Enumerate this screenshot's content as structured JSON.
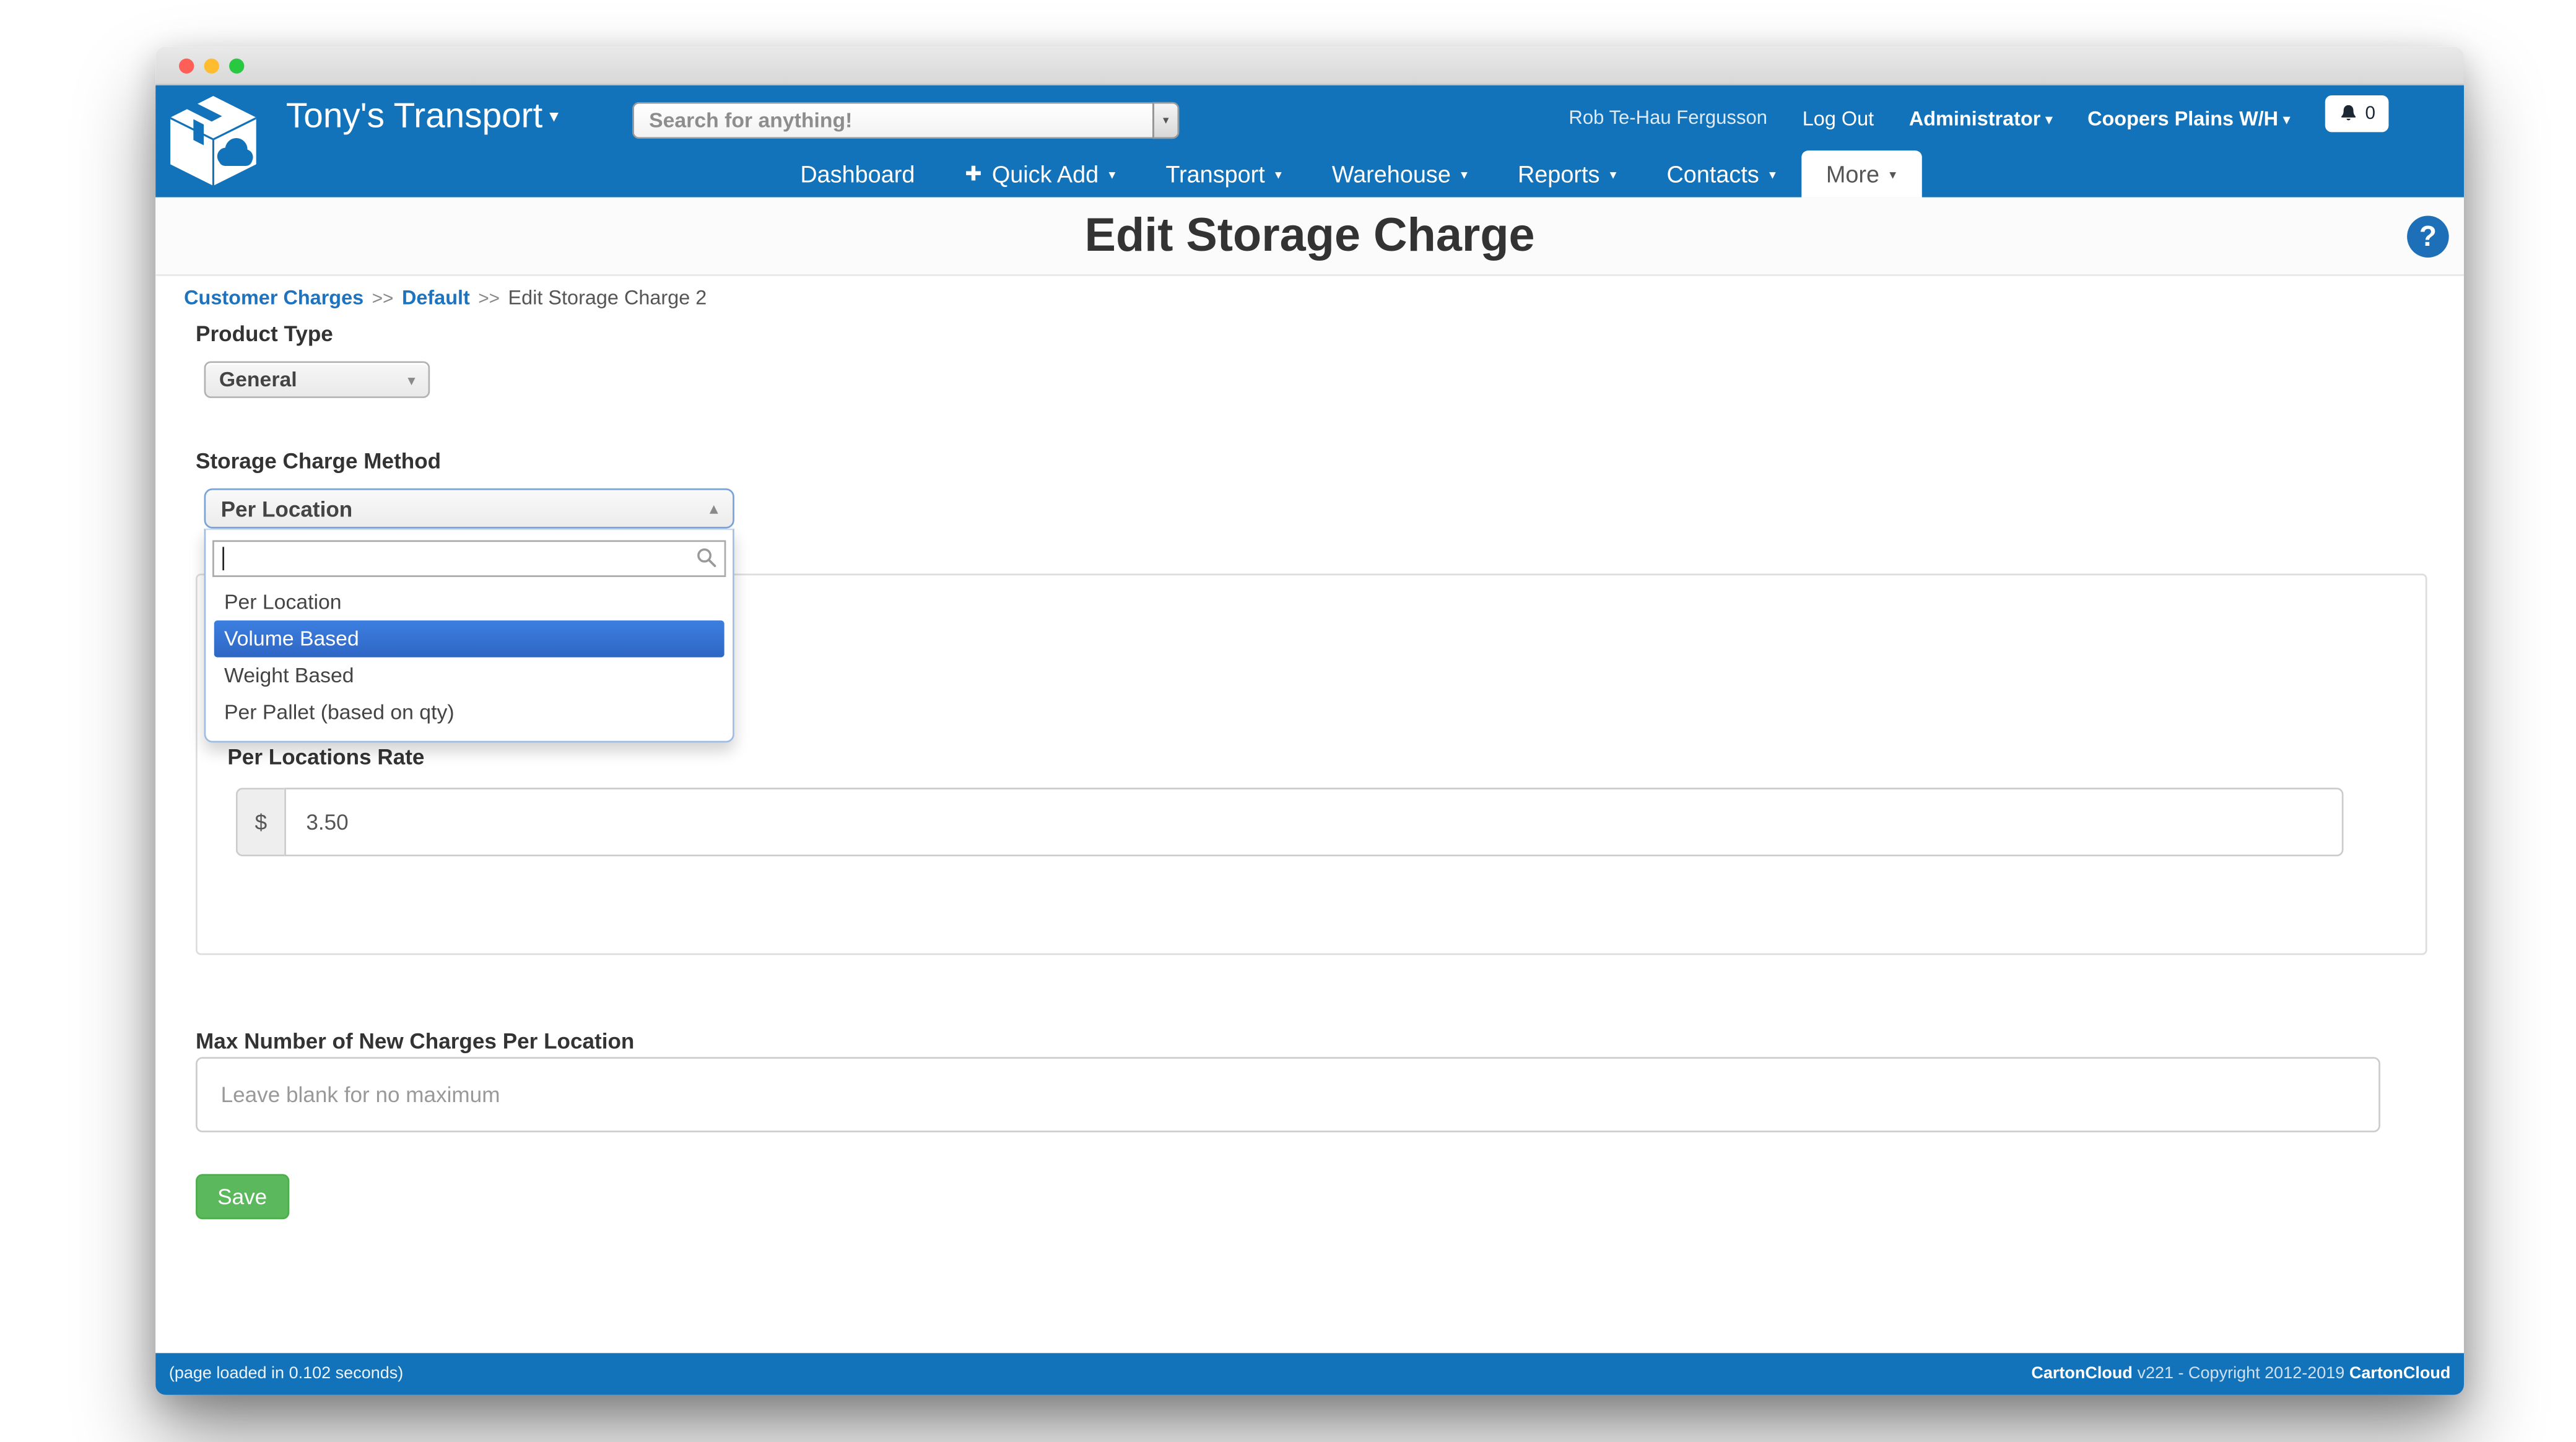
{
  "header": {
    "brand": "Tony's Transport",
    "search_placeholder": "Search for anything!",
    "user_name": "Rob Te-Hau Fergusson",
    "logout_label": "Log Out",
    "role_label": "Administrator",
    "warehouse_label": "Coopers Plains W/H",
    "notifications_count": "0",
    "nav": [
      {
        "label": "Dashboard"
      },
      {
        "label": "Quick Add"
      },
      {
        "label": "Transport"
      },
      {
        "label": "Warehouse"
      },
      {
        "label": "Reports"
      },
      {
        "label": "Contacts"
      },
      {
        "label": "More"
      }
    ]
  },
  "page": {
    "title": "Edit Storage Charge",
    "breadcrumb": {
      "link1": "Customer Charges",
      "sep1": ">>",
      "link2": "Default",
      "sep2": ">>",
      "current": "Edit Storage Charge 2"
    },
    "product_type_label": "Product Type",
    "product_type_value": "General",
    "method_label": "Storage Charge Method",
    "method_value": "Per Location",
    "method_search_value": "",
    "method_options": [
      "Per Location",
      "Volume Based",
      "Weight Based",
      "Per Pallet (based on qty)"
    ],
    "method_highlighted": "Volume Based",
    "rate_label": "Per Locations Rate",
    "rate_prefix": "$",
    "rate_value": "3.50",
    "max_label": "Max Number of New Charges Per Location",
    "max_placeholder": "Leave blank for no maximum",
    "save_label": "Save"
  },
  "footer": {
    "load_time": "(page loaded in 0.102 seconds)",
    "brand1": "CartonCloud",
    "middle": " v221 - Copyright 2012-2019 ",
    "brand2": "CartonCloud"
  },
  "icons": {
    "caret_down": "▾",
    "caret_up": "▴",
    "plus": "✚",
    "help": "?"
  },
  "colors": {
    "header_blue": "#1273ba",
    "highlight_blue": "#3875d7",
    "save_green": "#5cb85c",
    "link_blue": "#1e73be"
  }
}
